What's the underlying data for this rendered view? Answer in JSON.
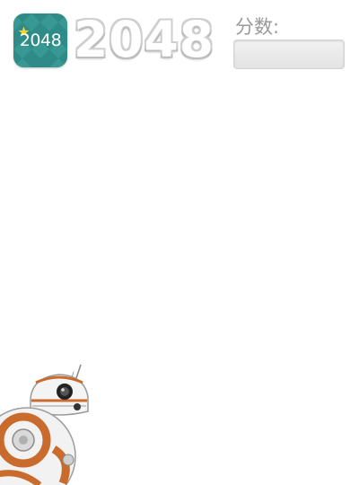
{
  "app_icon": {
    "text": "2048",
    "background": "#2e8b87",
    "star_color": "#f3d23c",
    "icon": "star-icon"
  },
  "header": {
    "title": "2048"
  },
  "score": {
    "label": "分数:",
    "value": ""
  },
  "illustration": {
    "icon": "bb8-droid-icon"
  }
}
